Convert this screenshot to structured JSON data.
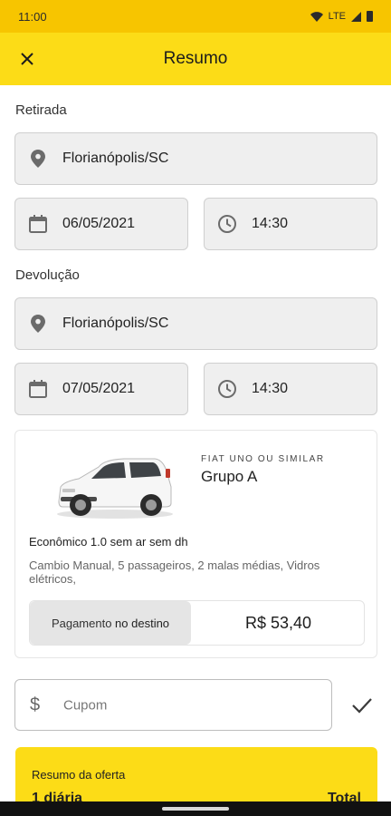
{
  "status_bar": {
    "time": "11:00",
    "network": "LTE"
  },
  "app_bar": {
    "title": "Resumo",
    "close_icon": "close-icon"
  },
  "pickup": {
    "label": "Retirada",
    "location": "Florianópolis/SC",
    "date": "06/05/2021",
    "time": "14:30"
  },
  "return": {
    "label": "Devolução",
    "location": "Florianópolis/SC",
    "date": "07/05/2021",
    "time": "14:30"
  },
  "car": {
    "subtitle": "FIAT UNO OU SIMILAR",
    "group": "Grupo A",
    "description": "Econômico 1.0 sem ar sem dh",
    "features": "Cambio Manual, 5 passageiros, 2 malas médias, Vidros elétricos,",
    "payment_prefix": "Pagamento ",
    "payment_emphasis": "no destino",
    "price": "R$ 53,40"
  },
  "coupon": {
    "symbol": "$",
    "placeholder": "Cupom"
  },
  "offer": {
    "title": "Resumo da oferta",
    "days": "1 diária",
    "total": "Total"
  },
  "colors": {
    "accent": "#fcdc17",
    "status_bar": "#f7c500",
    "field_bg": "#efefef"
  }
}
